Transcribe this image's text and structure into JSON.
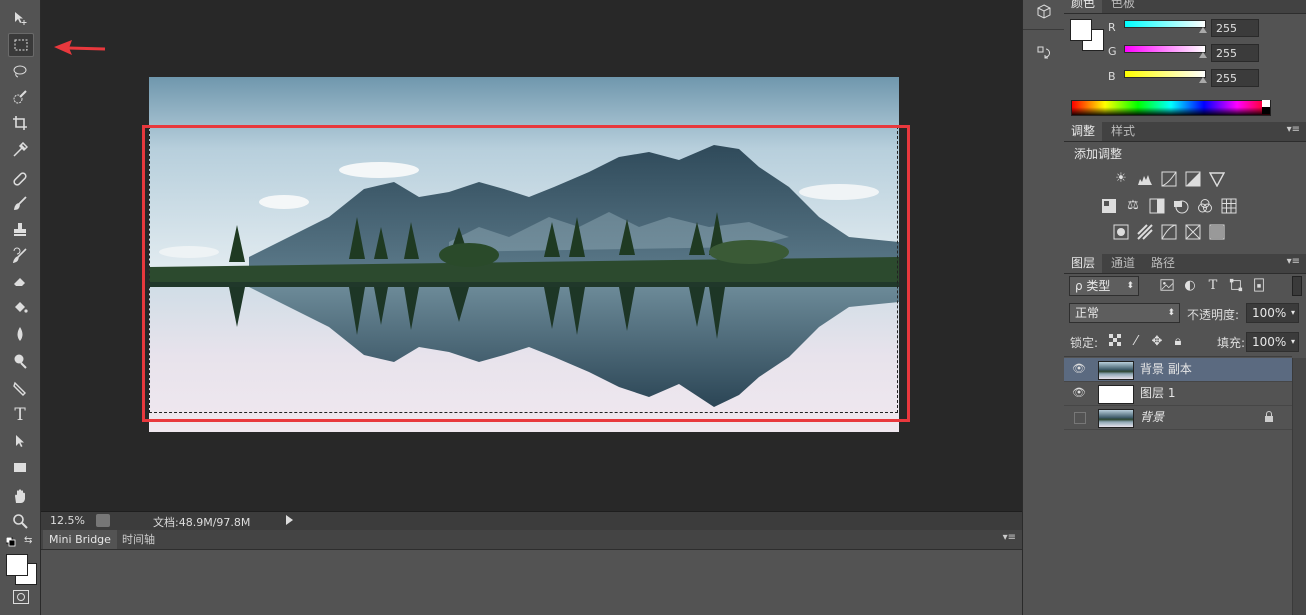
{
  "toolbar": {
    "tools": [
      "move-tool",
      "rect-marquee-tool",
      "lasso-tool",
      "quick-select-tool",
      "crop-tool",
      "eyedropper-tool",
      "healing-brush-tool",
      "brush-tool",
      "clone-stamp-tool",
      "history-brush-tool",
      "eraser-tool",
      "paint-bucket-tool",
      "blur-tool",
      "dodge-tool",
      "pen-tool",
      "type-tool",
      "path-select-tool",
      "rectangle-tool",
      "hand-tool",
      "zoom-tool"
    ],
    "type_label": "T"
  },
  "status": {
    "zoom": "12.5%",
    "doc_info": "文档:48.9M/97.8M"
  },
  "bottom_panel": {
    "tabs": [
      "Mini Bridge",
      "时间轴"
    ]
  },
  "color_panel": {
    "tabs": [
      "颜色",
      "色板"
    ],
    "r_label": "R",
    "g_label": "G",
    "b_label": "B",
    "r_value": "255",
    "g_value": "255",
    "b_value": "255"
  },
  "adjustments_panel": {
    "tabs": [
      "调整",
      "样式"
    ],
    "title": "添加调整"
  },
  "layers_panel": {
    "tabs": [
      "图层",
      "通道",
      "路径"
    ],
    "filter_label": "ρ 类型",
    "blend_mode": "正常",
    "opacity_label": "不透明度:",
    "opacity_value": "100%",
    "lock_label": "锁定:",
    "fill_label": "填充:",
    "fill_value": "100%",
    "layers": [
      {
        "name": "背景 副本",
        "visible": true,
        "selected": true
      },
      {
        "name": "图层 1",
        "visible": true,
        "selected": false
      },
      {
        "name": "背景",
        "visible": false,
        "selected": false
      }
    ]
  },
  "colors": {
    "annotation_red": "#e8383d",
    "accent_selected_layer": "#5b6a80"
  }
}
